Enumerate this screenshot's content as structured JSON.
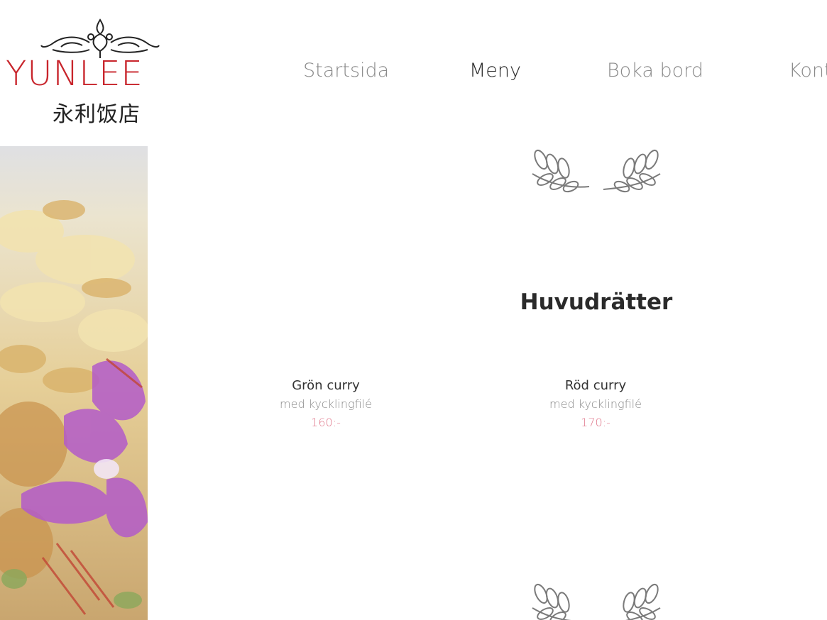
{
  "logo": {
    "brand": "YUNLEE",
    "chinese": "永利饭店",
    "brand_color": "#c8252c"
  },
  "nav": {
    "items": [
      {
        "label": "Startsida",
        "active": false
      },
      {
        "label": "Meny",
        "active": true
      },
      {
        "label": "Boka bord",
        "active": false
      },
      {
        "label": "Kontakt",
        "active": false
      }
    ]
  },
  "food_image": {
    "description_icon": "food-photo"
  },
  "menu": {
    "section_title": "Huvudrätter",
    "dishes": [
      {
        "name": "Grön curry",
        "desc": "med kycklingfilé",
        "price": "160:-"
      },
      {
        "name": "Röd curry",
        "desc": "med kycklingfilé",
        "price": "170:-"
      },
      {
        "name": "",
        "desc": "",
        "price": ""
      }
    ]
  },
  "colors": {
    "price": "#e07a8d",
    "nav_inactive": "#8a8a8a",
    "nav_active": "#2a2a2a"
  }
}
